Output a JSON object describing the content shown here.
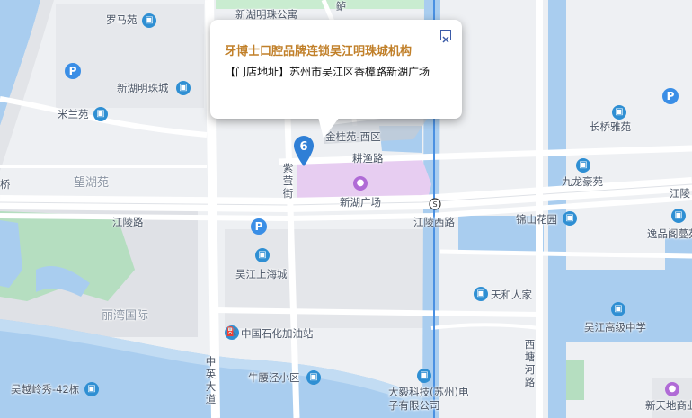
{
  "popup": {
    "title": "牙博士口腔品牌连锁吴江明珠城机构",
    "address": "【门店地址】苏州市吴江区香樟路新湖广场",
    "close_icon": "close-icon"
  },
  "marker": {
    "number": "6",
    "color": "#2f7fd6"
  },
  "colors": {
    "water": "#a9cdef",
    "green": "#b5dec0",
    "mall": "#e7cdf1",
    "road": "#ffffff",
    "metro": "#4a90e2"
  },
  "labels": {
    "luomayuan": "罗马苑",
    "xinhumingzhu_top": "新湖明珠公寓",
    "xinhumingzhucheng": "新湖明珠城",
    "milanyuan": "米兰苑",
    "wanghuyuan": "望湖苑",
    "jinguiyuan": "金桂苑-西区",
    "gengyulu": "耕渔路",
    "ziyingjie": "紫萤街",
    "xinhuguangchang": "新湖广场",
    "jianglinglu": "江陵路",
    "jianglingxilu": "江陵西路",
    "jianglingdong": "江陵",
    "jinshanhuayuan": "锦山花园",
    "changqiaoyayuan": "长桥雅苑",
    "jiulonghaoyuan": "九龙豪苑",
    "yipinlanmanyuan": "逸品阁蔓苑",
    "wujiangshanghaicheng": "吴江上海城",
    "liwanguoji": "丽湾国际",
    "tianherenjia": "天和人家",
    "wujianggaojizhongxue": "吴江高级中学",
    "zhongshihua": "中国石化加油站",
    "zhongyingdadao": "中英大道",
    "niuyaojingxiaoqu": "牛腰泾小区",
    "dayikeji": "大毅科技(苏州)电子有限公司",
    "xitanghelu": "西塘河路",
    "wuyuelingxiu": "吴越岭秀-42栋",
    "xintiandi": "新天地商业广",
    "qiao": "桥",
    "lu_top": "鲈"
  },
  "parking_label": "P"
}
